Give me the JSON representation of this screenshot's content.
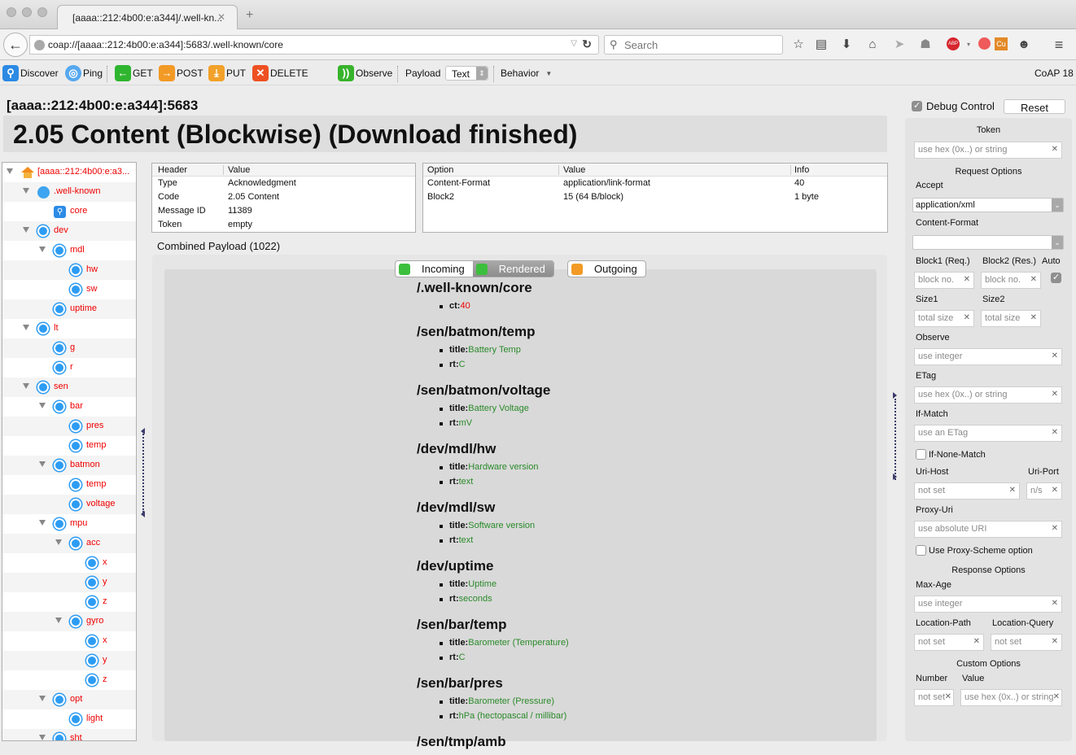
{
  "browser": {
    "tab_title": "[aaaa::212:4b00:e:a344]/.well-kn...",
    "url": "coap://[aaaa::212:4b00:e:a344]:5683/.well-known/core",
    "search_placeholder": "Search",
    "toolbar_icons": [
      "bookmark-star-icon",
      "reading-list-icon",
      "download-icon",
      "home-icon",
      "send-icon",
      "ghostery-icon",
      "adblock-plus-icon",
      "extension-icon",
      "copper-icon",
      "chat-icon",
      "menu-icon"
    ]
  },
  "coap_toolbar": {
    "discover": "Discover",
    "ping": "Ping",
    "get": "GET",
    "post": "POST",
    "put": "PUT",
    "delete": "DELETE",
    "observe": "Observe",
    "payload_label": "Payload",
    "payload_format": "Text",
    "behavior": "Behavior",
    "version": "CoAP 18"
  },
  "header": {
    "address": "[aaaa::212:4b00:e:a344]:5683",
    "status": "2.05 Content (Blockwise) (Download finished)"
  },
  "tree": [
    {
      "label": "[aaaa::212:4b00:e:a3...",
      "depth": 0,
      "expanded": true,
      "icon": "home"
    },
    {
      "label": ".well-known",
      "depth": 1,
      "expanded": true,
      "icon": "globe"
    },
    {
      "label": "core",
      "depth": 2,
      "icon": "search"
    },
    {
      "label": "dev",
      "depth": 1,
      "expanded": true,
      "icon": "resource"
    },
    {
      "label": "mdl",
      "depth": 2,
      "expanded": true,
      "icon": "resource"
    },
    {
      "label": "hw",
      "depth": 3,
      "icon": "resource"
    },
    {
      "label": "sw",
      "depth": 3,
      "icon": "resource"
    },
    {
      "label": "uptime",
      "depth": 2,
      "icon": "resource"
    },
    {
      "label": "lt",
      "depth": 1,
      "expanded": true,
      "icon": "resource"
    },
    {
      "label": "g",
      "depth": 2,
      "icon": "resource"
    },
    {
      "label": "r",
      "depth": 2,
      "icon": "resource"
    },
    {
      "label": "sen",
      "depth": 1,
      "expanded": true,
      "icon": "resource"
    },
    {
      "label": "bar",
      "depth": 2,
      "expanded": true,
      "icon": "resource"
    },
    {
      "label": "pres",
      "depth": 3,
      "icon": "resource"
    },
    {
      "label": "temp",
      "depth": 3,
      "icon": "resource"
    },
    {
      "label": "batmon",
      "depth": 2,
      "expanded": true,
      "icon": "resource"
    },
    {
      "label": "temp",
      "depth": 3,
      "icon": "resource"
    },
    {
      "label": "voltage",
      "depth": 3,
      "icon": "resource"
    },
    {
      "label": "mpu",
      "depth": 2,
      "expanded": true,
      "icon": "resource"
    },
    {
      "label": "acc",
      "depth": 3,
      "expanded": true,
      "icon": "resource"
    },
    {
      "label": "x",
      "depth": 4,
      "icon": "resource"
    },
    {
      "label": "y",
      "depth": 4,
      "icon": "resource"
    },
    {
      "label": "z",
      "depth": 4,
      "icon": "resource"
    },
    {
      "label": "gyro",
      "depth": 3,
      "expanded": true,
      "icon": "resource"
    },
    {
      "label": "x",
      "depth": 4,
      "icon": "resource"
    },
    {
      "label": "y",
      "depth": 4,
      "icon": "resource"
    },
    {
      "label": "z",
      "depth": 4,
      "icon": "resource"
    },
    {
      "label": "opt",
      "depth": 2,
      "expanded": true,
      "icon": "resource"
    },
    {
      "label": "light",
      "depth": 3,
      "icon": "resource"
    },
    {
      "label": "sht",
      "depth": 2,
      "expanded": true,
      "icon": "resource"
    }
  ],
  "headers_table": {
    "columns": [
      "Header",
      "Value"
    ],
    "rows": [
      [
        "Type",
        "Acknowledgment"
      ],
      [
        "Code",
        "2.05 Content"
      ],
      [
        "Message ID",
        "11389"
      ],
      [
        "Token",
        "empty"
      ]
    ]
  },
  "options_table": {
    "columns": [
      "Option",
      "Value",
      "Info"
    ],
    "rows": [
      [
        "Content-Format",
        "application/link-format",
        "40"
      ],
      [
        "Block2",
        "15 (64 B/block)",
        "1 byte"
      ]
    ]
  },
  "payload": {
    "label": "Combined Payload (1022)",
    "tabs": [
      "Incoming",
      "Rendered",
      "Outgoing"
    ],
    "active_tab": "Rendered",
    "resources": [
      {
        "path": "/.well-known/core",
        "attrs": [
          {
            "k": "ct:",
            "v": "40",
            "red": true
          }
        ]
      },
      {
        "path": "/sen/batmon/temp",
        "attrs": [
          {
            "k": "title:",
            "v": "Battery Temp"
          },
          {
            "k": "rt:",
            "v": "C"
          }
        ]
      },
      {
        "path": "/sen/batmon/voltage",
        "attrs": [
          {
            "k": "title:",
            "v": "Battery Voltage"
          },
          {
            "k": "rt:",
            "v": "mV"
          }
        ]
      },
      {
        "path": "/dev/mdl/hw",
        "attrs": [
          {
            "k": "title:",
            "v": "Hardware version"
          },
          {
            "k": "rt:",
            "v": "text"
          }
        ]
      },
      {
        "path": "/dev/mdl/sw",
        "attrs": [
          {
            "k": "title:",
            "v": "Software version"
          },
          {
            "k": "rt:",
            "v": "text"
          }
        ]
      },
      {
        "path": "/dev/uptime",
        "attrs": [
          {
            "k": "title:",
            "v": "Uptime"
          },
          {
            "k": "rt:",
            "v": "seconds"
          }
        ]
      },
      {
        "path": "/sen/bar/temp",
        "attrs": [
          {
            "k": "title:",
            "v": "Barometer (Temperature)"
          },
          {
            "k": "rt:",
            "v": "C"
          }
        ]
      },
      {
        "path": "/sen/bar/pres",
        "attrs": [
          {
            "k": "title:",
            "v": "Barometer (Pressure)"
          },
          {
            "k": "rt:",
            "v": "hPa (hectopascal / millibar)"
          }
        ]
      },
      {
        "path": "/sen/tmp/amb",
        "attrs": []
      }
    ]
  },
  "debug": {
    "debug_control_label": "Debug Control",
    "debug_control_checked": true,
    "reset": "Reset",
    "token_label": "Token",
    "token_placeholder": "use hex (0x..) or string",
    "request_options": "Request Options",
    "accept_label": "Accept",
    "accept_value": "application/xml",
    "content_format_label": "Content-Format",
    "content_format_value": "",
    "block1_label": "Block1 (Req.)",
    "block2_label": "Block2 (Res.)",
    "auto_label": "Auto",
    "auto_checked": true,
    "block_placeholder": "block no.",
    "size1_label": "Size1",
    "size2_label": "Size2",
    "size_placeholder": "total size",
    "observe_label": "Observe",
    "integer_placeholder": "use integer",
    "etag_label": "ETag",
    "etag_placeholder": "use hex (0x..) or string",
    "ifmatch_label": "If-Match",
    "ifmatch_placeholder": "use an ETag",
    "ifnonematch_label": "If-None-Match",
    "urihost_label": "Uri-Host",
    "uriport_label": "Uri-Port",
    "notset_placeholder": "not set",
    "port_placeholder": "n/s",
    "proxyuri_label": "Proxy-Uri",
    "proxyuri_placeholder": "use absolute URI",
    "proxyscheme_label": "Use Proxy-Scheme option",
    "response_options": "Response Options",
    "maxage_label": "Max-Age",
    "locpath_label": "Location-Path",
    "locquery_label": "Location-Query",
    "custom_options": "Custom Options",
    "number_label": "Number",
    "value_label": "Value",
    "custom_number_placeholder": "not set",
    "custom_value_placeholder": "use hex (0x..) or string"
  }
}
